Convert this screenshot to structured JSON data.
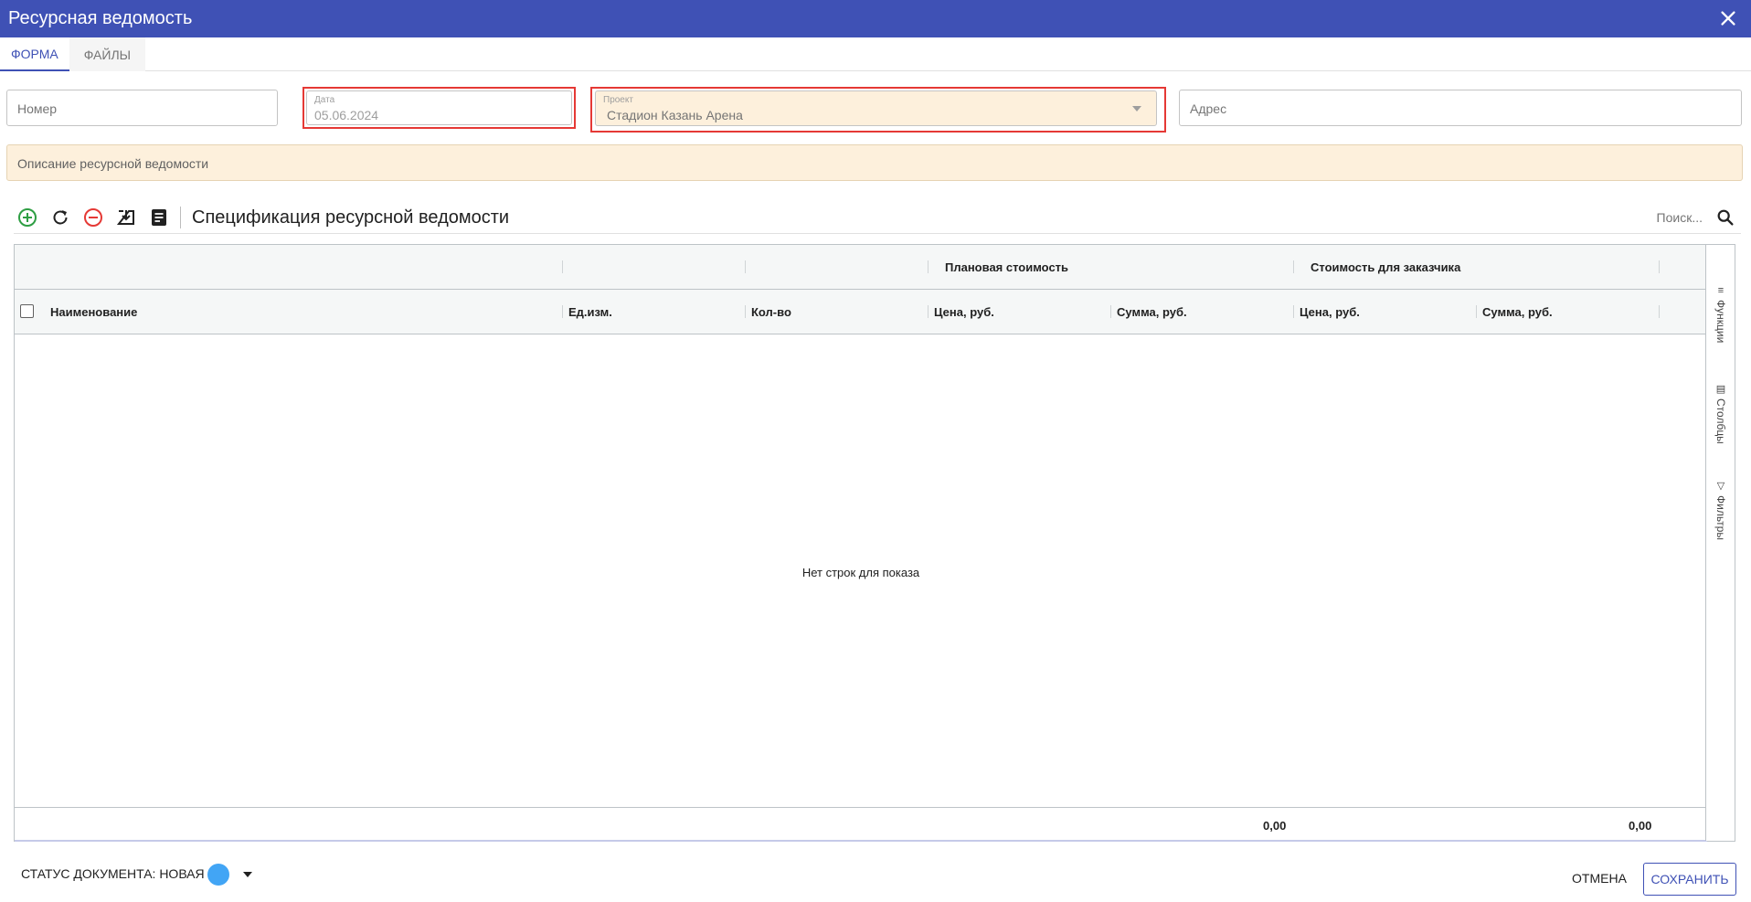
{
  "window": {
    "title": "Ресурсная ведомость",
    "close_icon": "close-icon"
  },
  "tabs": [
    {
      "label": "Форма",
      "active": true
    },
    {
      "label": "Файлы",
      "active": false
    }
  ],
  "form": {
    "number": {
      "placeholder": "Номер",
      "value": ""
    },
    "date": {
      "label": "Дата",
      "value": "05.06.2024"
    },
    "project": {
      "label": "Проект",
      "value": "Стадион Казань Арена"
    },
    "address": {
      "placeholder": "Адрес",
      "value": ""
    },
    "description": {
      "placeholder": "Описание ресурсной ведомости"
    }
  },
  "toolbar": {
    "icons": [
      "add-circle-icon",
      "refresh-icon",
      "remove-circle-icon",
      "download-icon",
      "document-icon"
    ],
    "title": "Спецификация ресурсной ведомости",
    "search_placeholder": "Поиск..."
  },
  "grid": {
    "group_headers": {
      "plan": "Плановая стоимость",
      "customer": "Стоимость для заказчика"
    },
    "columns": [
      "Наименование",
      "Ед.изм.",
      "Кол-во",
      "Цена, руб.",
      "Сумма, руб.",
      "Цена, руб.",
      "Сумма, руб."
    ],
    "empty_text": "Нет строк для показа",
    "totals": {
      "plan_sum": "0,00",
      "customer_sum": "0,00"
    },
    "side_panel": [
      "Функции",
      "Столбцы",
      "Фильтры"
    ]
  },
  "footer": {
    "status_label": "Статус документа: Новая",
    "status_color": "#42a5f5",
    "cancel_label": "Отмена",
    "save_label": "Сохранить"
  },
  "colors": {
    "header": "#3f51b5",
    "highlight": "#e53935",
    "description_bg": "#fdf0dc"
  }
}
